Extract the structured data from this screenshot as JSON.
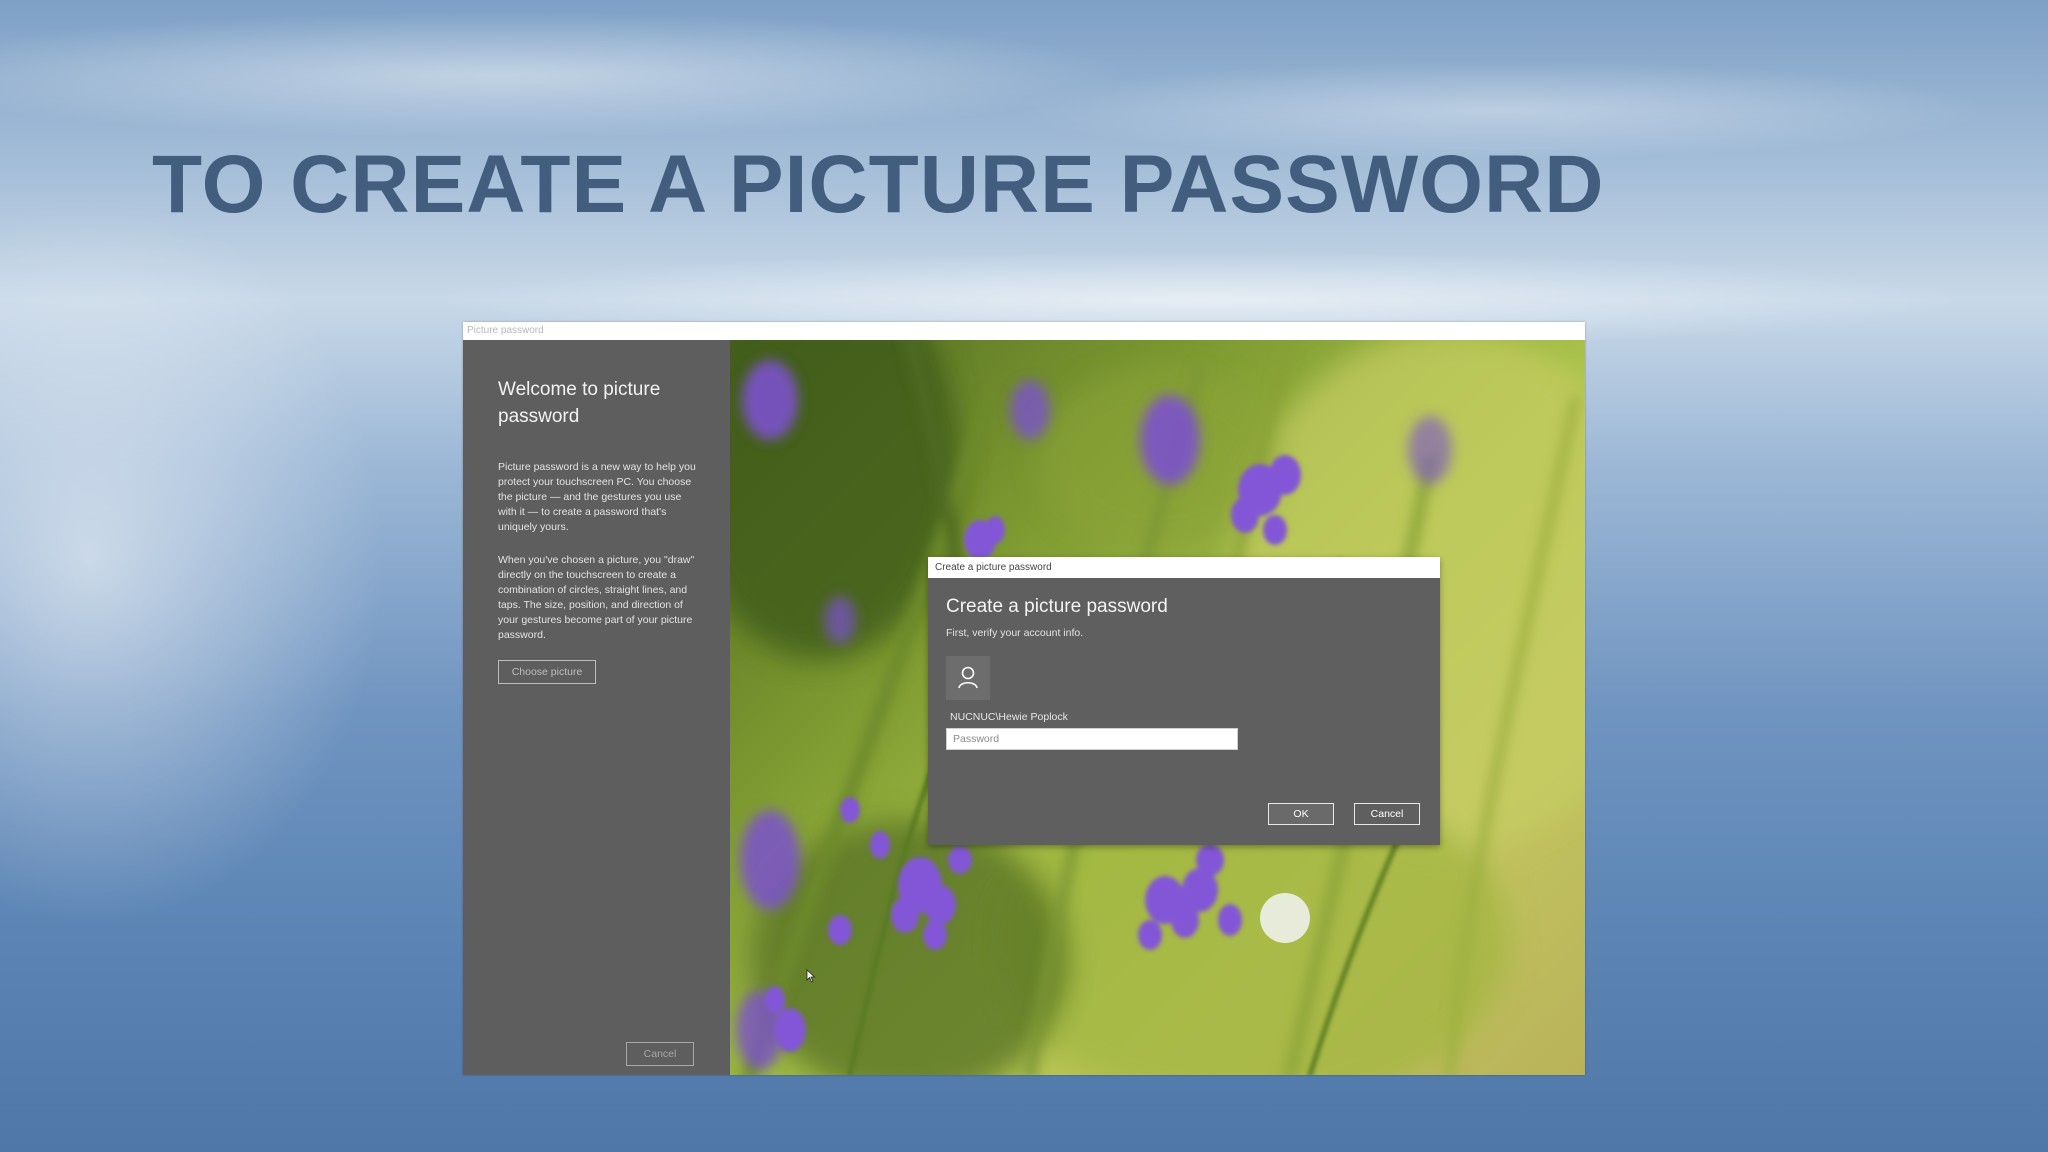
{
  "slide": {
    "title": "TO CREATE A PICTURE PASSWORD"
  },
  "app_window": {
    "title": "Picture password",
    "left_panel": {
      "heading": "Welcome to picture password",
      "paragraph_1": "Picture password is a new way to help you protect your touchscreen PC. You choose the picture — and the gestures you use with it — to create a password that's uniquely yours.",
      "paragraph_2": "When you've chosen a picture, you \"draw\" directly on the touchscreen to create a combination of circles, straight lines, and taps. The size, position, and direction of your gestures become part of your picture password.",
      "choose_picture_label": "Choose picture",
      "cancel_label": "Cancel"
    }
  },
  "dialog": {
    "title": "Create a picture password",
    "heading": "Create a picture password",
    "subtitle": "First, verify your account info.",
    "avatar_icon": "user-icon",
    "account_name": "NUCNUC\\Hewie Poplock",
    "password_placeholder": "Password",
    "password_value": "",
    "ok_label": "OK",
    "cancel_label": "Cancel"
  },
  "colors": {
    "title_text": "#435d7f",
    "panel_gray": "#5f5f5f",
    "lavender": "#7a4fc9"
  }
}
